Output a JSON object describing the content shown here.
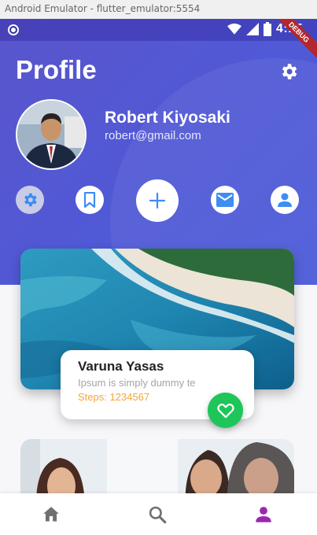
{
  "window": {
    "title": "Android Emulator - flutter_emulator:5554"
  },
  "status_bar": {
    "time": "4:15",
    "debug_label": "DEBUG"
  },
  "header": {
    "title": "Profile"
  },
  "user": {
    "name": "Robert Kiyosaki",
    "email": "robert@gmail.com"
  },
  "actions": [
    "settings-icon",
    "bookmark-icon",
    "add-icon",
    "mail-icon",
    "person-icon"
  ],
  "card": {
    "name": "Varuna Yasas",
    "description": "Ipsum is simply dummy te",
    "steps": "Steps: 1234567"
  },
  "bottom_nav": [
    "home-icon",
    "search-icon",
    "person-icon"
  ],
  "colors": {
    "header_gradient_start": "#5a55cc",
    "header_gradient_end": "#4a5ad8",
    "accent_blue": "#3d8df2",
    "steps_orange": "#f4a538",
    "fav_green": "#1ec65a",
    "nav_active": "#9b27b0",
    "nav_inactive": "#6f6f6f"
  }
}
